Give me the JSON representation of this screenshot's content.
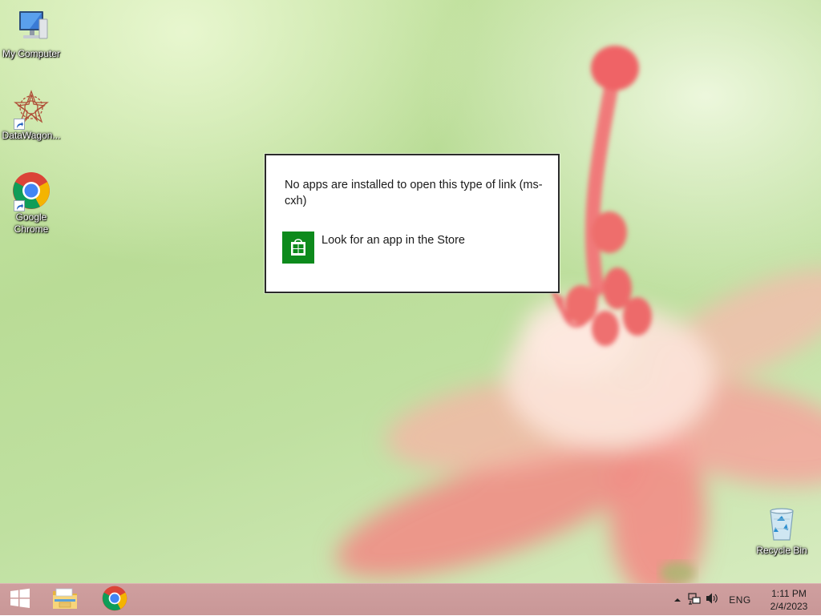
{
  "desktop": {
    "icons": [
      {
        "label": "My Computer",
        "icon": "computer-icon"
      },
      {
        "label": "DataWagon...",
        "icon": "datawagon-icon"
      },
      {
        "label": "Google Chrome",
        "icon": "chrome-icon"
      },
      {
        "label": "Recycle Bin",
        "icon": "recycle-bin-icon"
      }
    ]
  },
  "dialog": {
    "message": "No apps are installed to open this type of link (ms-cxh)",
    "store_option_label": "Look for an app in the Store",
    "store_icon": "store-icon",
    "store_color": "#0d8a1c"
  },
  "taskbar": {
    "start_icon": "windows-logo-icon",
    "pinned": [
      {
        "name": "file-explorer",
        "icon": "folder-icon"
      },
      {
        "name": "google-chrome",
        "icon": "chrome-icon"
      }
    ],
    "tray": {
      "show_hidden_icon": "chevron-up-icon",
      "network_icon": "network-icon",
      "volume_icon": "volume-icon",
      "language": "ENG",
      "time": "1:11 PM",
      "date": "2/4/2023"
    }
  },
  "colors": {
    "taskbar": "#cf9f9f",
    "wallpaper": "#c9e6a6"
  }
}
